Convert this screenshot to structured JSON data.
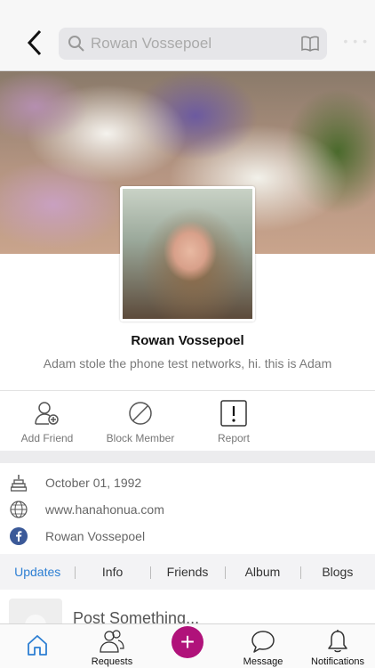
{
  "header": {
    "search_placeholder": "Rowan Vossepoel",
    "more": "• • •"
  },
  "profile": {
    "name": "Rowan Vossepoel",
    "bio": "Adam stole the phone test networks, hi. this is Adam"
  },
  "actions": [
    {
      "label": "Add Friend",
      "icon": "add-friend-icon"
    },
    {
      "label": "Block Member",
      "icon": "block-icon"
    },
    {
      "label": "Report",
      "icon": "report-icon"
    }
  ],
  "info": {
    "birthday": "October 01, 1992",
    "website": "www.hanahonua.com",
    "facebook": "Rowan Vossepoel"
  },
  "tabs": [
    {
      "label": "Updates",
      "active": true
    },
    {
      "label": "Info"
    },
    {
      "label": "Friends"
    },
    {
      "label": "Album"
    },
    {
      "label": "Blogs"
    }
  ],
  "post": {
    "placeholder": "Post Something..."
  },
  "tabbar": [
    {
      "label": "",
      "icon": "home-icon"
    },
    {
      "label": "Requests",
      "icon": "requests-icon"
    },
    {
      "label": "",
      "icon": "plus-icon"
    },
    {
      "label": "Message",
      "icon": "message-icon"
    },
    {
      "label": "Notifications",
      "icon": "bell-icon"
    }
  ],
  "colors": {
    "accent": "#2d7fd3",
    "fab": "#b0127a",
    "facebook": "#3b5998"
  }
}
